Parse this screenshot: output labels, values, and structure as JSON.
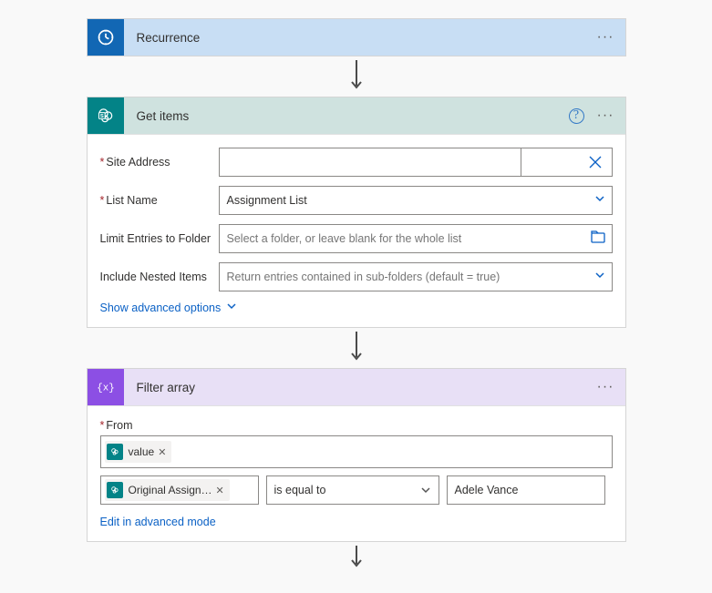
{
  "recurrence": {
    "title": "Recurrence"
  },
  "getitems": {
    "title": "Get items",
    "labels": {
      "site": "Site Address",
      "list": "List Name",
      "limit": "Limit Entries to Folder",
      "nested": "Include Nested Items"
    },
    "values": {
      "site": "",
      "list": "Assignment List",
      "limit_placeholder": "Select a folder, or leave blank for the whole list",
      "nested_placeholder": "Return entries contained in sub-folders (default = true)"
    },
    "advanced": "Show advanced options"
  },
  "filter": {
    "title": "Filter array",
    "from_label": "From",
    "token_value": "value",
    "token_original": "Original Assign…",
    "operator": "is equal to",
    "compare_value": "Adele Vance",
    "edit_adv": "Edit in advanced mode"
  }
}
